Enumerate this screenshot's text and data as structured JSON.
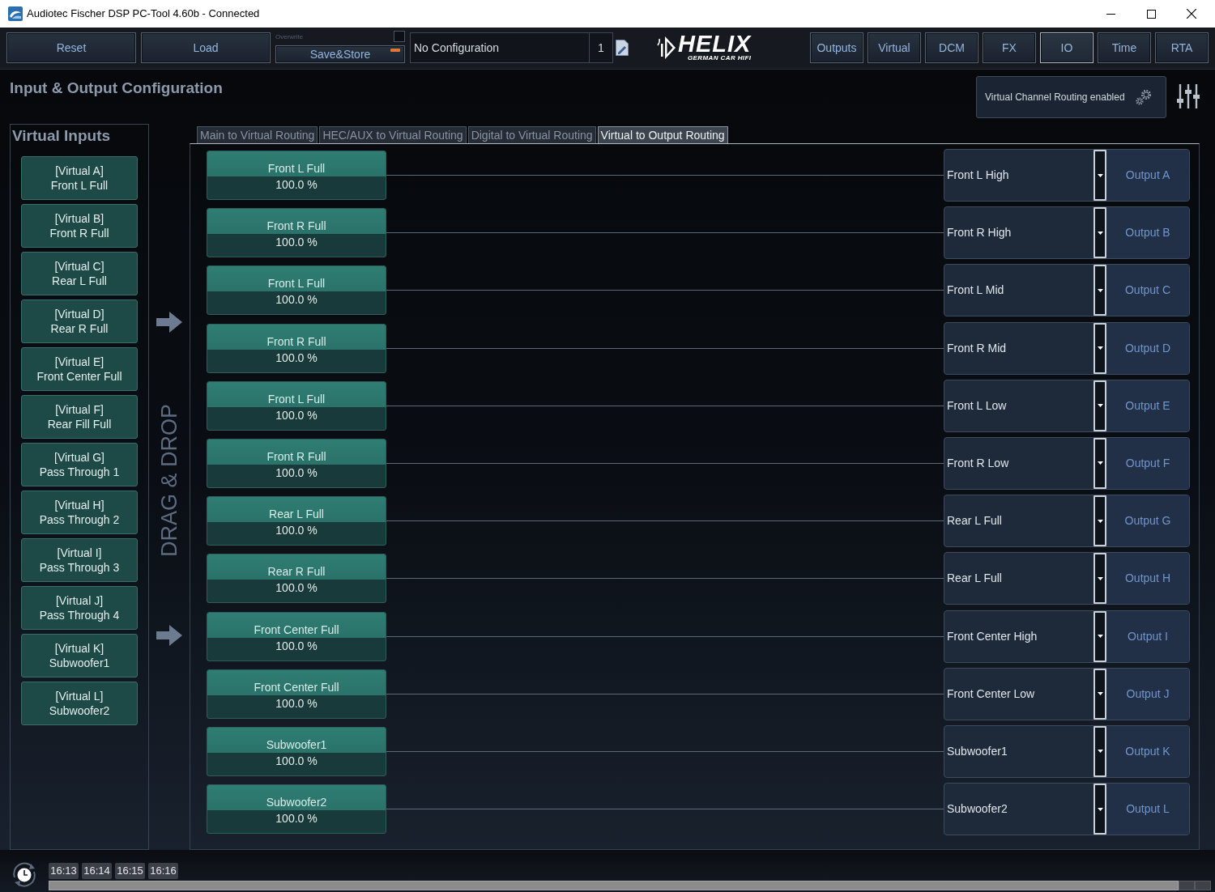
{
  "window": {
    "title": "Audiotec Fischer DSP PC-Tool 4.60b - Connected"
  },
  "toolbar": {
    "buttons": [
      "Reset",
      "Load"
    ],
    "overwrite": {
      "label": "Overwrite",
      "checked": false
    },
    "save_button": "Save&Store",
    "configuration": "No Configuration",
    "preset_number": "1",
    "logo": {
      "wordmark": "HELIX",
      "tagline": "GERMAN CAR HIFI"
    },
    "nav_tabs": [
      {
        "label": "Outputs",
        "selected": false
      },
      {
        "label": "Virtual",
        "selected": false
      },
      {
        "label": "DCM",
        "selected": false
      },
      {
        "label": "FX",
        "selected": false
      },
      {
        "label": "IO",
        "selected": true
      },
      {
        "label": "Time",
        "selected": false
      },
      {
        "label": "RTA",
        "selected": false
      }
    ]
  },
  "header": {
    "title": "Input & Output Configuration",
    "routing_status": "Virtual Channel Routing enabled"
  },
  "virtual_inputs": {
    "title": "Virtual Inputs",
    "items": [
      {
        "slot": "[Virtual A]",
        "name": "Front L Full"
      },
      {
        "slot": "[Virtual B]",
        "name": "Front R Full"
      },
      {
        "slot": "[Virtual C]",
        "name": "Rear L Full"
      },
      {
        "slot": "[Virtual D]",
        "name": "Rear R Full"
      },
      {
        "slot": "[Virtual E]",
        "name": "Front Center Full"
      },
      {
        "slot": "[Virtual F]",
        "name": "Rear Fill Full"
      },
      {
        "slot": "[Virtual G]",
        "name": "Pass Through 1"
      },
      {
        "slot": "[Virtual H]",
        "name": "Pass Through 2"
      },
      {
        "slot": "[Virtual I]",
        "name": "Pass Through 3"
      },
      {
        "slot": "[Virtual J]",
        "name": "Pass Through 4"
      },
      {
        "slot": "[Virtual K]",
        "name": "Subwoofer1"
      },
      {
        "slot": "[Virtual L]",
        "name": "Subwoofer2"
      }
    ]
  },
  "drag_drop_label": "DRAG & DROP",
  "routing_tabs": [
    {
      "label": "Main to Virtual Routing",
      "selected": false
    },
    {
      "label": "HEC/AUX to Virtual Routing",
      "selected": false
    },
    {
      "label": "Digital to Virtual Routing",
      "selected": false
    },
    {
      "label": "Virtual to Output Routing",
      "selected": true
    }
  ],
  "routes": [
    {
      "source": "Front L Full",
      "gain": "100.0 %",
      "target": "Front L High",
      "output": "Output A"
    },
    {
      "source": "Front R Full",
      "gain": "100.0 %",
      "target": "Front R High",
      "output": "Output B"
    },
    {
      "source": "Front L Full",
      "gain": "100.0 %",
      "target": "Front L Mid",
      "output": "Output C"
    },
    {
      "source": "Front R Full",
      "gain": "100.0 %",
      "target": "Front R Mid",
      "output": "Output D"
    },
    {
      "source": "Front L Full",
      "gain": "100.0 %",
      "target": "Front L Low",
      "output": "Output E"
    },
    {
      "source": "Front R Full",
      "gain": "100.0 %",
      "target": "Front R Low",
      "output": "Output F"
    },
    {
      "source": "Rear L Full",
      "gain": "100.0 %",
      "target": "Rear L Full",
      "output": "Output G"
    },
    {
      "source": "Rear R Full",
      "gain": "100.0 %",
      "target": "Rear L Full",
      "output": "Output H"
    },
    {
      "source": "Front Center Full",
      "gain": "100.0 %",
      "target": "Front Center High",
      "output": "Output I"
    },
    {
      "source": "Front Center Full",
      "gain": "100.0 %",
      "target": "Front Center Low",
      "output": "Output J"
    },
    {
      "source": "Subwoofer1",
      "gain": "100.0 %",
      "target": "Subwoofer1",
      "output": "Output K"
    },
    {
      "source": "Subwoofer2",
      "gain": "100.0 %",
      "target": "Subwoofer2",
      "output": "Output L"
    }
  ],
  "timeline": {
    "markers": [
      "16:13",
      "16:14",
      "16:15",
      "16:16"
    ]
  }
}
